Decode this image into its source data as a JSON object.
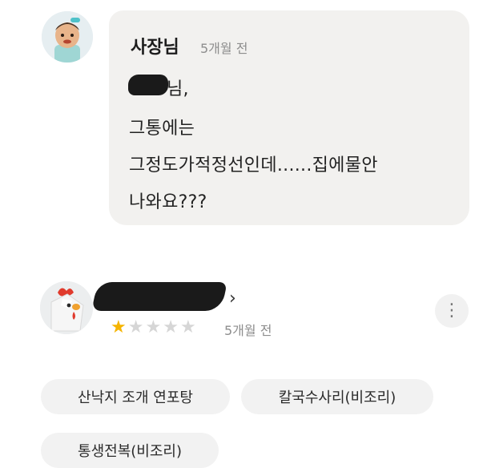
{
  "owner_reply": {
    "name": "사장님",
    "time": "5개월 전",
    "lines": [
      "님,",
      "그통에는",
      "그정도가적정선인데......집에물안",
      "나와요???"
    ]
  },
  "review": {
    "time": "5개월 전",
    "rating": 1,
    "max_rating": 5,
    "arrow": "›",
    "more": "⋮"
  },
  "menu_chips": [
    "산낙지 조개 연포탕",
    "칼국수사리(비조리)",
    "통생전복(비조리)"
  ],
  "colors": {
    "star_filled": "#f5b400",
    "star_empty": "#d6d6d6",
    "bubble": "#f2f1ef"
  }
}
